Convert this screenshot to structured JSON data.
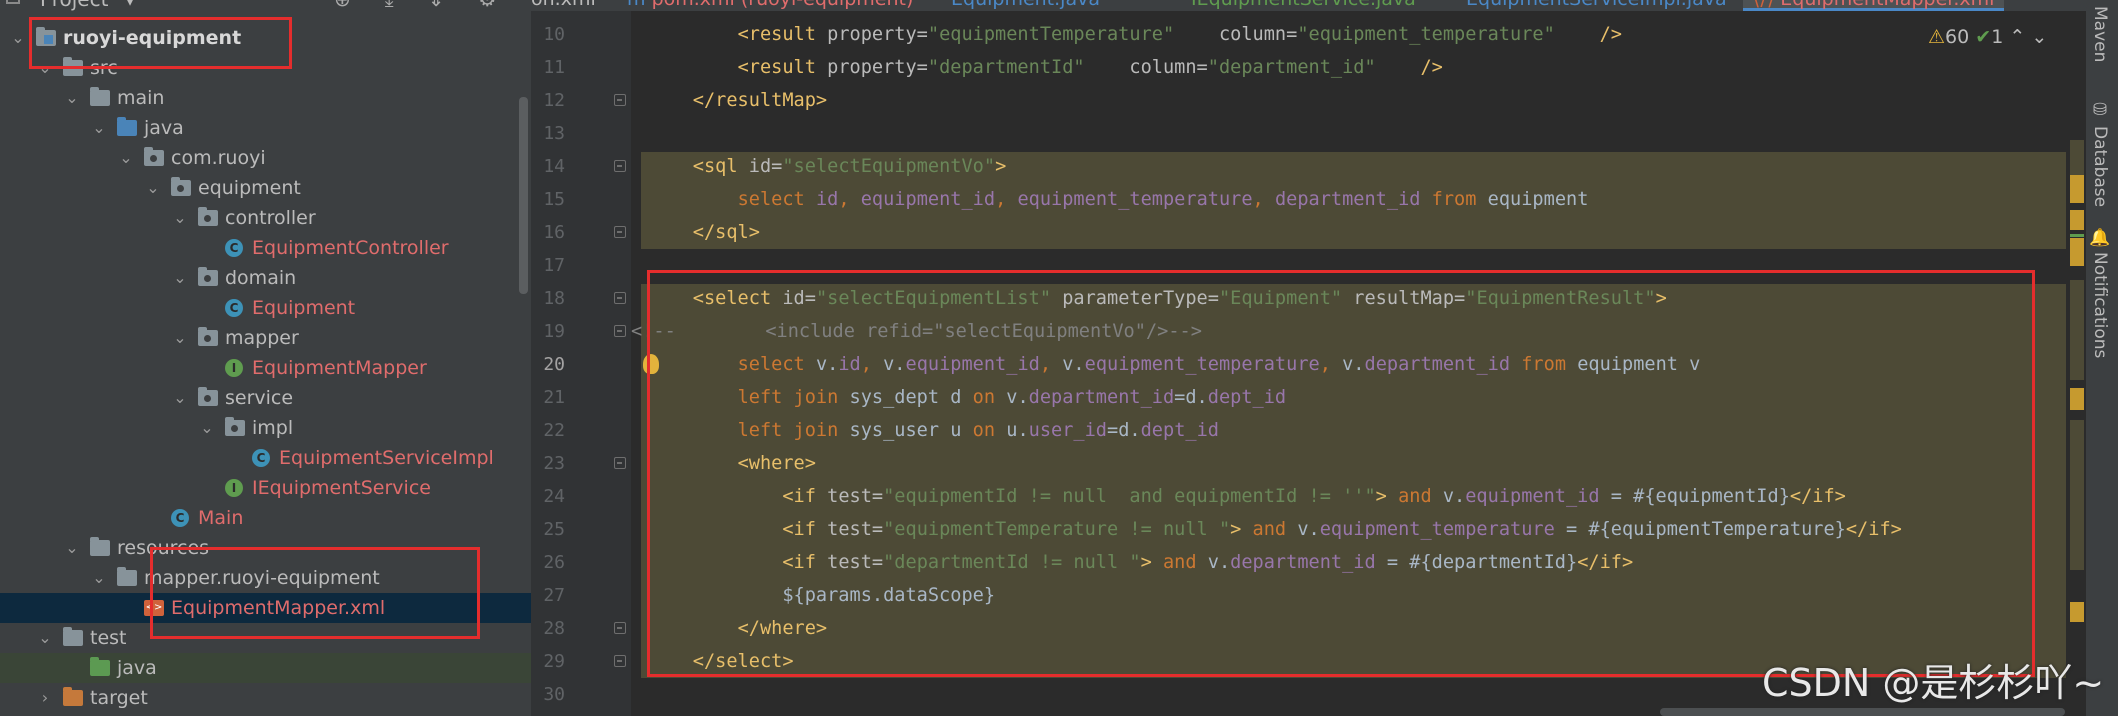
{
  "project_panel": {
    "title": "Project",
    "tree": [
      {
        "label": "ruoyi-equipment",
        "icon": "module-folder-icon",
        "expanded": true
      },
      {
        "label": "src",
        "icon": "folder-icon",
        "expanded": true
      },
      {
        "label": "main",
        "icon": "folder-icon",
        "expanded": true
      },
      {
        "label": "java",
        "icon": "source-folder-icon",
        "expanded": true
      },
      {
        "label": "com.ruoyi",
        "icon": "package-icon",
        "expanded": true
      },
      {
        "label": "equipment",
        "icon": "package-icon",
        "expanded": true
      },
      {
        "label": "controller",
        "icon": "package-icon",
        "expanded": true
      },
      {
        "label": "EquipmentController",
        "icon": "class-icon"
      },
      {
        "label": "domain",
        "icon": "package-icon",
        "expanded": true
      },
      {
        "label": "Equipment",
        "icon": "class-icon"
      },
      {
        "label": "mapper",
        "icon": "package-icon",
        "expanded": true
      },
      {
        "label": "EquipmentMapper",
        "icon": "interface-icon"
      },
      {
        "label": "service",
        "icon": "package-icon",
        "expanded": true
      },
      {
        "label": "impl",
        "icon": "package-icon",
        "expanded": true
      },
      {
        "label": "EquipmentServiceImpl",
        "icon": "class-icon"
      },
      {
        "label": "IEquipmentService",
        "icon": "interface-icon"
      },
      {
        "label": "Main",
        "icon": "main-class-icon"
      },
      {
        "label": "resources",
        "icon": "resources-folder-icon",
        "expanded": true
      },
      {
        "label": "mapper.ruoyi-equipment",
        "icon": "folder-icon",
        "expanded": true
      },
      {
        "label": "EquipmentMapper.xml",
        "icon": "xml-file-icon",
        "selected": true
      },
      {
        "label": "test",
        "icon": "folder-icon",
        "expanded": true
      },
      {
        "label": "java",
        "icon": "test-source-folder-icon"
      },
      {
        "label": "target",
        "icon": "excluded-folder-icon",
        "expanded": false
      }
    ]
  },
  "tabs": [
    {
      "label": "on.xml"
    },
    {
      "label": "pom.xml (ruoyi-equipment)"
    },
    {
      "label": "Equipment.java"
    },
    {
      "label": "IEquipmentService.java"
    },
    {
      "label": "EquipmentServiceImpl.java"
    },
    {
      "label": "EquipmentMapper.xml",
      "active": true
    }
  ],
  "inspections": {
    "warnings": "60",
    "ok": "1"
  },
  "editor": {
    "lines": [
      {
        "no": "10",
        "segs": [
          [
            "plain",
            "        "
          ],
          [
            "tag",
            "<result "
          ],
          [
            "attr",
            "property="
          ],
          [
            "str",
            "\"equipmentTemperature\""
          ],
          [
            "plain",
            "    "
          ],
          [
            "attr",
            "column="
          ],
          [
            "str",
            "\"equipment_temperature\""
          ],
          [
            "plain",
            "    "
          ],
          [
            "tag",
            "/>"
          ]
        ]
      },
      {
        "no": "11",
        "segs": [
          [
            "plain",
            "        "
          ],
          [
            "tag",
            "<result "
          ],
          [
            "attr",
            "property="
          ],
          [
            "str",
            "\"departmentId\""
          ],
          [
            "plain",
            "    "
          ],
          [
            "attr",
            "column="
          ],
          [
            "str",
            "\"department_id\""
          ],
          [
            "plain",
            "    "
          ],
          [
            "tag",
            "/>"
          ]
        ]
      },
      {
        "no": "12",
        "segs": [
          [
            "plain",
            "    "
          ],
          [
            "tag",
            "</resultMap>"
          ]
        ]
      },
      {
        "no": "13",
        "segs": []
      },
      {
        "no": "14",
        "segs": [
          [
            "plain",
            "    "
          ],
          [
            "tag",
            "<sql "
          ],
          [
            "attr",
            "id="
          ],
          [
            "str",
            "\"selectEquipmentVo\""
          ],
          [
            "tag",
            ">"
          ]
        ]
      },
      {
        "no": "15",
        "segs": [
          [
            "plain",
            "        "
          ],
          [
            "kw",
            "select "
          ],
          [
            "field",
            "id"
          ],
          [
            "kw",
            ", "
          ],
          [
            "field",
            "equipment_id"
          ],
          [
            "kw",
            ", "
          ],
          [
            "field",
            "equipment_temperature"
          ],
          [
            "kw",
            ", "
          ],
          [
            "field",
            "department_id "
          ],
          [
            "kw",
            "from "
          ],
          [
            "plain",
            "equipment"
          ]
        ]
      },
      {
        "no": "16",
        "segs": [
          [
            "plain",
            "    "
          ],
          [
            "tag",
            "</sql>"
          ]
        ]
      },
      {
        "no": "17",
        "segs": []
      },
      {
        "no": "18",
        "segs": [
          [
            "plain",
            "    "
          ],
          [
            "tag",
            "<select "
          ],
          [
            "attr",
            "id="
          ],
          [
            "str",
            "\"selectEquipmentList\" "
          ],
          [
            "attr",
            "parameterType="
          ],
          [
            "str",
            "\"Equipment\" "
          ],
          [
            "attr",
            "resultMap="
          ],
          [
            "str",
            "\"EquipmentResult\""
          ],
          [
            "tag",
            ">"
          ]
        ]
      },
      {
        "no": "19",
        "segs": [
          [
            "comment",
            "<!--        <include refid=\"selectEquipmentVo\"/>-->"
          ]
        ]
      },
      {
        "no": "20",
        "segs": [
          [
            "plain",
            "        "
          ],
          [
            "kw",
            "select "
          ],
          [
            "plain",
            "v."
          ],
          [
            "field",
            "id"
          ],
          [
            "kw",
            ", "
          ],
          [
            "plain",
            "v."
          ],
          [
            "field",
            "equipment_id"
          ],
          [
            "kw",
            ", "
          ],
          [
            "plain",
            "v."
          ],
          [
            "field",
            "equipment_temperature"
          ],
          [
            "kw",
            ", "
          ],
          [
            "plain",
            "v."
          ],
          [
            "field",
            "department_id "
          ],
          [
            "kw",
            "from "
          ],
          [
            "plain",
            "equipment v"
          ]
        ]
      },
      {
        "no": "21",
        "segs": [
          [
            "plain",
            "        "
          ],
          [
            "kw",
            "left join "
          ],
          [
            "plain",
            "sys_dept d "
          ],
          [
            "kw",
            "on "
          ],
          [
            "plain",
            "v."
          ],
          [
            "field",
            "department_id"
          ],
          [
            "plain",
            "=d."
          ],
          [
            "field",
            "dept_id"
          ]
        ]
      },
      {
        "no": "22",
        "segs": [
          [
            "plain",
            "        "
          ],
          [
            "kw",
            "left join "
          ],
          [
            "plain",
            "sys_user u "
          ],
          [
            "kw",
            "on "
          ],
          [
            "plain",
            "u."
          ],
          [
            "field",
            "user_id"
          ],
          [
            "plain",
            "=d."
          ],
          [
            "field",
            "dept_id"
          ]
        ]
      },
      {
        "no": "23",
        "segs": [
          [
            "plain",
            "        "
          ],
          [
            "tag",
            "<where>"
          ]
        ]
      },
      {
        "no": "24",
        "segs": [
          [
            "plain",
            "            "
          ],
          [
            "tag",
            "<if "
          ],
          [
            "attr",
            "test="
          ],
          [
            "str",
            "\"equipmentId != null  and equipmentId != ''\""
          ],
          [
            "tag",
            "> "
          ],
          [
            "kw",
            "and "
          ],
          [
            "plain",
            "v."
          ],
          [
            "field",
            "equipment_id"
          ],
          [
            "plain",
            " = #{equipmentId}"
          ],
          [
            "tag",
            "</if>"
          ]
        ]
      },
      {
        "no": "25",
        "segs": [
          [
            "plain",
            "            "
          ],
          [
            "tag",
            "<if "
          ],
          [
            "attr",
            "test="
          ],
          [
            "str",
            "\"equipmentTemperature != null \""
          ],
          [
            "tag",
            "> "
          ],
          [
            "kw",
            "and "
          ],
          [
            "plain",
            "v."
          ],
          [
            "field",
            "equipment_temperature"
          ],
          [
            "plain",
            " = #{equipmentTemperature}"
          ],
          [
            "tag",
            "</if>"
          ]
        ]
      },
      {
        "no": "26",
        "segs": [
          [
            "plain",
            "            "
          ],
          [
            "tag",
            "<if "
          ],
          [
            "attr",
            "test="
          ],
          [
            "str",
            "\"departmentId != null \""
          ],
          [
            "tag",
            "> "
          ],
          [
            "kw",
            "and "
          ],
          [
            "plain",
            "v."
          ],
          [
            "field",
            "department_id"
          ],
          [
            "plain",
            " = #{departmentId}"
          ],
          [
            "tag",
            "</if>"
          ]
        ]
      },
      {
        "no": "27",
        "segs": [
          [
            "plain",
            "            ${params.dataScope}"
          ]
        ]
      },
      {
        "no": "28",
        "segs": [
          [
            "plain",
            "        "
          ],
          [
            "tag",
            "</where>"
          ]
        ]
      },
      {
        "no": "29",
        "segs": [
          [
            "plain",
            "    "
          ],
          [
            "tag",
            "</select>"
          ]
        ]
      },
      {
        "no": "30",
        "segs": []
      }
    ]
  },
  "right_strip": {
    "tools": [
      "Maven",
      "Database",
      "Notifications"
    ]
  },
  "watermark": "CSDN @是杉杉吖~",
  "colors": {
    "annotation_red": "#e52d2d",
    "tag": "#e8bf6a",
    "string": "#6a8759",
    "keyword": "#cc7832",
    "field": "#9876aa",
    "highlight": "#4d4a36"
  }
}
